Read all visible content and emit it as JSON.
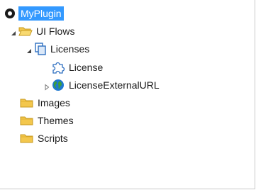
{
  "tree": {
    "root": {
      "label": "MyPlugin",
      "icon": "plugin-root-icon"
    },
    "ui_flows": {
      "label": "UI Flows",
      "icon": "open-folder-icon",
      "expanded": true
    },
    "licenses": {
      "label": "Licenses",
      "icon": "flow-pages-icon",
      "expanded": true
    },
    "license": {
      "label": "License",
      "icon": "puzzle-piece-icon"
    },
    "license_external_url": {
      "label": "LicenseExternalURL",
      "icon": "globe-icon",
      "expanded": false
    },
    "images": {
      "label": "Images",
      "icon": "folder-icon"
    },
    "themes": {
      "label": "Themes",
      "icon": "folder-icon"
    },
    "scripts": {
      "label": "Scripts",
      "icon": "folder-icon"
    }
  },
  "colors": {
    "selection": "#3399ff",
    "folder": "#f3c74d",
    "folder_outline": "#c79a1f",
    "flow_icon": "#2e6fc0",
    "globe_water": "#1e78d0",
    "globe_land": "#3c9e3c"
  }
}
